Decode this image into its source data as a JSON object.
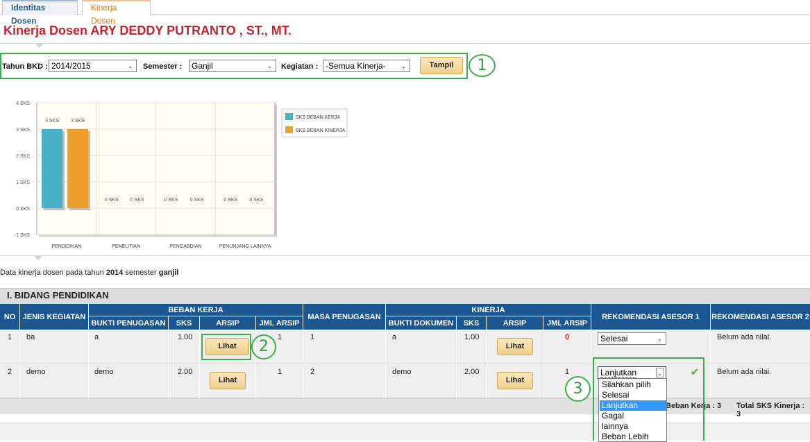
{
  "tabs": [
    "Identitas Dosen",
    "Kinerja Dosen"
  ],
  "title": "Kinerja Dosen ARY DEDDY PUTRANTO , ST., MT.",
  "filters": {
    "tahun_label": "Tahun BKD :",
    "tahun_value": "2014/2015",
    "semester_label": "Semester :",
    "semester_value": "Ganjil",
    "kegiatan_label": "Kegiatan :",
    "kegiatan_value": "-Semua Kinerja-",
    "button": "Tampil"
  },
  "annotations": [
    "1",
    "2",
    "3"
  ],
  "colors": {
    "title": "#c8222a",
    "header": "#1a5792",
    "series1": "#4ab0c6",
    "series2": "#ec9f2b",
    "highlight": "#3aae49"
  },
  "chart_data": {
    "type": "bar",
    "categories": [
      "PENDIDIKAN",
      "PENELITIAN",
      "PENGABDIAN",
      "PENUNJANG LAINNYA"
    ],
    "series": [
      {
        "name": "SKS BEBAN KERJA",
        "values": [
          3,
          0,
          0,
          0
        ]
      },
      {
        "name": "SKS BEBAN KINERJA",
        "values": [
          3,
          0,
          0,
          0
        ]
      }
    ],
    "data_labels": [
      [
        "3 SKS",
        "0 SKS",
        "0 SKS",
        "0 SKS"
      ],
      [
        "3 SKS",
        "0 SKS",
        "0 SKS",
        "0 SKS"
      ]
    ],
    "yticks": [
      "4 SKS",
      "3 SKS",
      "2 SKS",
      "1 SKS",
      "0 SKS",
      "-1 SKS"
    ],
    "ylim": [
      -1,
      4
    ],
    "grid": true,
    "legend": "right"
  },
  "info": {
    "prefix": "Data kinerja dosen pada tahun ",
    "year": "2014",
    "mid": " semester ",
    "semester": "ganjil"
  },
  "section": {
    "title": "I. BIDANG PENDIDIKAN",
    "headers": {
      "no": "NO",
      "jenis": "JENIS KEGIATAN",
      "beban": "BEBAN KERJA",
      "bukti": "BUKTI PENUGASAN",
      "sks": "SKS",
      "arsip": "ARSIP",
      "jml": "JML ARSIP",
      "masa": "MASA PENUGASAN",
      "kinerja": "KINERJA",
      "bukti_dok": "BUKTI DOKUMEN",
      "sks2": "SKS",
      "arsip2": "ARSIP",
      "jml2": "JML ARSIP",
      "rek1": "REKOMENDASI ASESOR 1",
      "rek2": "REKOMENDASI ASESOR 2"
    },
    "rows": [
      {
        "no": "1",
        "jenis": "ba",
        "bukti": "a",
        "sks": "1.00",
        "lihat": "Lihat",
        "jml": "1",
        "masa": "1",
        "bukti_dok": "a",
        "sks2": "1.00",
        "lihat2": "Lihat",
        "jml2": "0",
        "rek1": "Selesai",
        "rek2": "Belum ada nilai."
      },
      {
        "no": "2",
        "jenis": "demo",
        "bukti": "demo",
        "sks": "2.00",
        "lihat": "Lihat",
        "jml": "1",
        "masa": "2",
        "bukti_dok": "demo",
        "sks2": "2.00",
        "lihat2": "Lihat",
        "jml2": "1",
        "rek1": "Lanjutkan",
        "rek2": "Belum ada nilai."
      }
    ],
    "dropdown_options": [
      "Silahkan pilih",
      "Selesai",
      "Lanjutkan",
      "Gagal",
      "lainnya",
      "Beban Lebih"
    ],
    "dropdown_selected": "Lanjutkan",
    "footer_beban": "Beban Kerja : 3",
    "footer_kinerja": "Total SKS Kinerja : 3"
  }
}
